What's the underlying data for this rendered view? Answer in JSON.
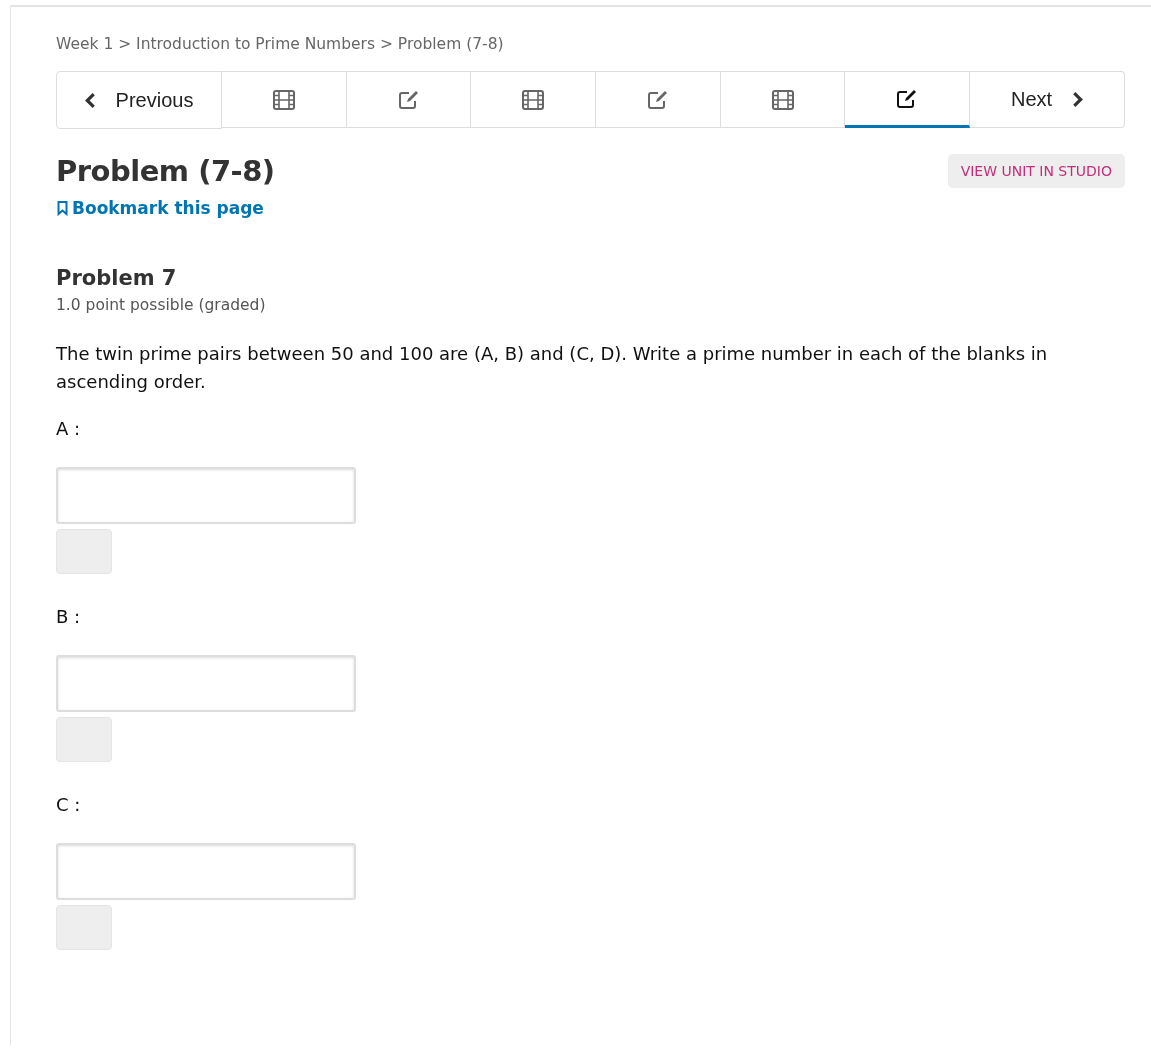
{
  "breadcrumb": "Week 1 > Introduction to Prime Numbers > Problem (7-8)",
  "nav": {
    "previous": "Previous",
    "next": "Next",
    "tabs": [
      {
        "kind": "video",
        "selected": false
      },
      {
        "kind": "problem",
        "selected": false
      },
      {
        "kind": "video",
        "selected": false
      },
      {
        "kind": "problem",
        "selected": false
      },
      {
        "kind": "video",
        "selected": false
      },
      {
        "kind": "problem",
        "selected": true
      }
    ]
  },
  "title": "Problem (7-8)",
  "studio_button": "VIEW UNIT IN STUDIO",
  "bookmark": "Bookmark this page",
  "problem": {
    "title": "Problem 7",
    "points": "1.0 point possible (graded)",
    "question": "The twin prime pairs between 50 and 100 are (A, B) and (C, D). Write a prime number in each of the blanks in ascending order.",
    "answers": [
      {
        "label": "A :"
      },
      {
        "label": "B :"
      },
      {
        "label": "C :"
      }
    ]
  }
}
